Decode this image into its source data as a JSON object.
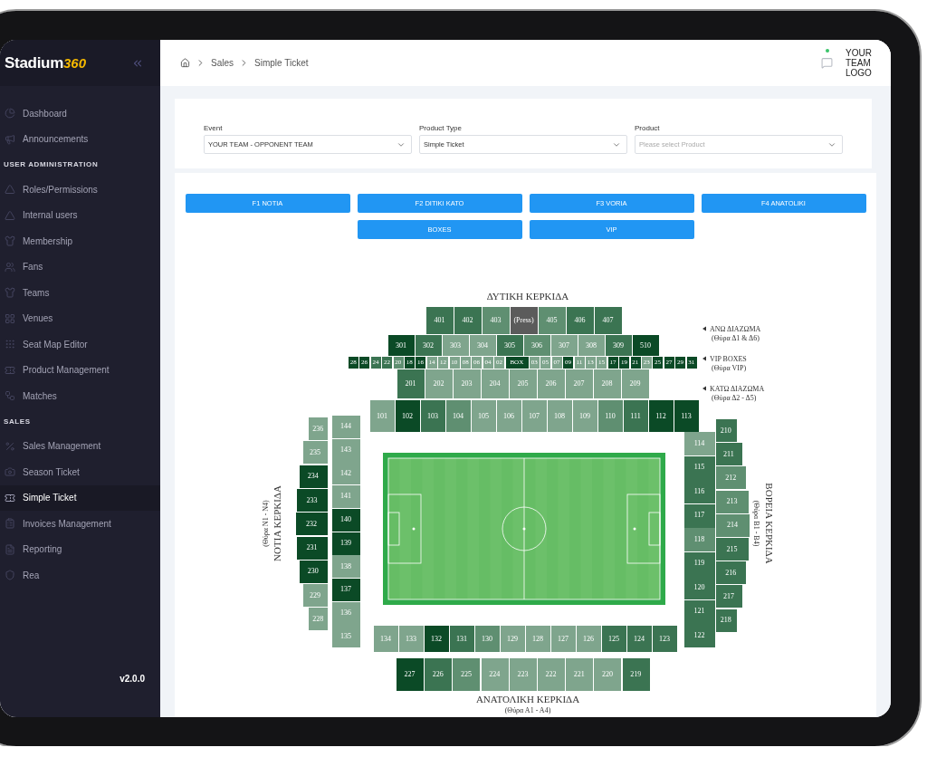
{
  "brand": {
    "name": "Stadium",
    "suffix": "360"
  },
  "sidebar": {
    "items": [
      {
        "kind": "item",
        "label": "Dashboard",
        "selected": false
      },
      {
        "kind": "item",
        "label": "Announcements",
        "selected": false
      },
      {
        "kind": "section",
        "label": "USER ADMINISTRATION"
      },
      {
        "kind": "item",
        "label": "Roles/Permissions",
        "selected": false
      },
      {
        "kind": "item",
        "label": "Internal users",
        "selected": false
      },
      {
        "kind": "item",
        "label": "Membership",
        "selected": false
      },
      {
        "kind": "item",
        "label": "Fans",
        "selected": false
      },
      {
        "kind": "item",
        "label": "Teams",
        "selected": false
      },
      {
        "kind": "item",
        "label": "Venues",
        "selected": false
      },
      {
        "kind": "item",
        "label": "Seat Map Editor",
        "selected": false
      },
      {
        "kind": "item",
        "label": "Product Management",
        "selected": false
      },
      {
        "kind": "item",
        "label": "Matches",
        "selected": false
      },
      {
        "kind": "section",
        "label": "SALES"
      },
      {
        "kind": "item",
        "label": "Sales Management",
        "selected": false
      },
      {
        "kind": "item",
        "label": "Season Ticket",
        "selected": false
      },
      {
        "kind": "item",
        "label": "Simple Ticket",
        "selected": true
      },
      {
        "kind": "item",
        "label": "Invoices Management",
        "selected": false
      },
      {
        "kind": "item",
        "label": "Reporting",
        "selected": false
      },
      {
        "kind": "item",
        "label": "Rea",
        "selected": false
      }
    ],
    "version": "v2.0.0"
  },
  "breadcrumb": [
    "Sales",
    "Simple Ticket"
  ],
  "team_logo": "YOUR TEAM LOGO",
  "filters": [
    {
      "label": "Event",
      "value": "YOUR TEAM - OPPONENT TEAM"
    },
    {
      "label": "Product Type",
      "value": "Simple Ticket"
    },
    {
      "label": "Product",
      "placeholder": "Please select Product"
    }
  ],
  "zone_buttons": [
    "F1 NOTIA",
    "F2 DITIKI KATO",
    "F3 VORIA",
    "F4 ANATOLIKI",
    "BOXES",
    "VIP"
  ],
  "stadium": {
    "west": {
      "name": "ΔΥΤΙΚΗ ΚΕΡΚΙΔΑ",
      "tiers": [
        {
          "sections": [
            {
              "label": "401",
              "color": "#3b7452"
            },
            {
              "label": "402",
              "color": "#3b7452"
            },
            {
              "label": "403",
              "color": "#5f8f71"
            },
            {
              "label": "(Press)",
              "color": "#5b5b5b"
            },
            {
              "label": "405",
              "color": "#5f8f71"
            },
            {
              "label": "406",
              "color": "#3b7452"
            },
            {
              "label": "407",
              "color": "#3b7452"
            }
          ]
        },
        {
          "sections": [
            {
              "label": "301",
              "color": "#0b4a26"
            },
            {
              "label": "302",
              "color": "#3b7452"
            },
            {
              "label": "303",
              "color": "#7fa58d"
            },
            {
              "label": "304",
              "color": "#7fa58d"
            },
            {
              "label": "305",
              "color": "#3b7452"
            },
            {
              "label": "306",
              "color": "#5f8f71"
            },
            {
              "label": "307",
              "color": "#7fa58d"
            },
            {
              "label": "308",
              "color": "#7fa58d"
            },
            {
              "label": "309",
              "color": "#3b7452"
            },
            {
              "label": "510",
              "color": "#0b4a26"
            }
          ]
        },
        {
          "sections": [
            {
              "label": "28",
              "color": "#0b4a26"
            },
            {
              "label": "26",
              "color": "#0b4a26"
            },
            {
              "label": "24",
              "color": "#3b7452"
            },
            {
              "label": "22",
              "color": "#3b7452"
            },
            {
              "label": "20",
              "color": "#5f8f71"
            },
            {
              "label": "18",
              "color": "#0b4a26"
            },
            {
              "label": "16",
              "color": "#0b4a26"
            },
            {
              "label": "14",
              "color": "#7fa58d"
            },
            {
              "label": "12",
              "color": "#7fa58d"
            },
            {
              "label": "10",
              "color": "#7fa58d"
            },
            {
              "label": "08",
              "color": "#7fa58d"
            },
            {
              "label": "06",
              "color": "#7fa58d"
            },
            {
              "label": "04",
              "color": "#7fa58d"
            },
            {
              "label": "02",
              "color": "#7fa58d"
            },
            {
              "label": "BOX",
              "color": "#0b4a26"
            },
            {
              "label": "03",
              "color": "#7fa58d"
            },
            {
              "label": "05",
              "color": "#7fa58d"
            },
            {
              "label": "07",
              "color": "#7fa58d"
            },
            {
              "label": "09",
              "color": "#0b4a26"
            },
            {
              "label": "11",
              "color": "#7fa58d"
            },
            {
              "label": "13",
              "color": "#7fa58d"
            },
            {
              "label": "15",
              "color": "#7fa58d"
            },
            {
              "label": "17",
              "color": "#0b4a26"
            },
            {
              "label": "19",
              "color": "#0b4a26"
            },
            {
              "label": "21",
              "color": "#0b4a26"
            },
            {
              "label": "23",
              "color": "#7fa58d"
            },
            {
              "label": "25",
              "color": "#0b4a26"
            },
            {
              "label": "27",
              "color": "#0b4a26"
            },
            {
              "label": "29",
              "color": "#0b4a26"
            },
            {
              "label": "31",
              "color": "#0b4a26"
            }
          ]
        },
        {
          "sections": [
            {
              "label": "201",
              "color": "#3b7452"
            },
            {
              "label": "202",
              "color": "#7fa58d"
            },
            {
              "label": "203",
              "color": "#7fa58d"
            },
            {
              "label": "204",
              "color": "#7fa58d"
            },
            {
              "label": "205",
              "color": "#7fa58d"
            },
            {
              "label": "206",
              "color": "#7fa58d"
            },
            {
              "label": "207",
              "color": "#7fa58d"
            },
            {
              "label": "208",
              "color": "#7fa58d"
            },
            {
              "label": "209",
              "color": "#7fa58d"
            }
          ]
        },
        {
          "sections": [
            {
              "label": "101",
              "color": "#7fa58d"
            },
            {
              "label": "102",
              "color": "#0b4a26"
            },
            {
              "label": "103",
              "color": "#3b7452"
            },
            {
              "label": "104",
              "color": "#5f8f71"
            },
            {
              "label": "105",
              "color": "#7fa58d"
            },
            {
              "label": "106",
              "color": "#7fa58d"
            },
            {
              "label": "107",
              "color": "#7fa58d"
            },
            {
              "label": "108",
              "color": "#7fa58d"
            },
            {
              "label": "109",
              "color": "#7fa58d"
            },
            {
              "label": "110",
              "color": "#5f8f71"
            },
            {
              "label": "111",
              "color": "#3b7452"
            },
            {
              "label": "112",
              "color": "#0b4a26"
            },
            {
              "label": "113",
              "color": "#0b4a26"
            }
          ]
        }
      ]
    },
    "legend": [
      {
        "label": "ΑΝΩ ΔΙΑΖΩΜΑ",
        "gate": "(Θύρα Δ1 & Δ6)"
      },
      {
        "label": "VIP BOXES",
        "gate": "(Θύρα VIP)"
      },
      {
        "label": "ΚΑΤΩ ΔΙΑΖΩΜΑ",
        "gate": "(Θύρα Δ2 - Δ5)"
      }
    ],
    "south": {
      "name": "ΝΟΤΙΑ ΚΕΡΚΙΔΑ",
      "gate": "(Θύρα Ν1 - Ν4)",
      "inner": [
        {
          "label": "144",
          "color": "#7fa58d"
        },
        {
          "label": "143",
          "color": "#7fa58d"
        },
        {
          "label": "142",
          "color": "#7fa58d"
        },
        {
          "label": "141",
          "color": "#7fa58d"
        },
        {
          "label": "140",
          "color": "#0b4a26"
        },
        {
          "label": "139",
          "color": "#0b4a26"
        },
        {
          "label": "138",
          "color": "#7fa58d"
        },
        {
          "label": "137",
          "color": "#0b4a26"
        },
        {
          "label": "136",
          "color": "#7fa58d"
        },
        {
          "label": "135",
          "color": "#7fa58d"
        }
      ],
      "outer": [
        {
          "label": "236",
          "color": "#7fa58d"
        },
        {
          "label": "235",
          "color": "#7fa58d"
        },
        {
          "label": "234",
          "color": "#0b4a26"
        },
        {
          "label": "233",
          "color": "#0b4a26"
        },
        {
          "label": "232",
          "color": "#0b4a26"
        },
        {
          "label": "231",
          "color": "#0b4a26"
        },
        {
          "label": "230",
          "color": "#0b4a26"
        },
        {
          "label": "229",
          "color": "#7fa58d"
        },
        {
          "label": "228",
          "color": "#7fa58d"
        }
      ]
    },
    "north": {
      "name": "ΒΟΡΕΙΑ ΚΕΡΚΙΔΑ",
      "gate": "(Θύρα Β1 - Β4)",
      "inner": [
        {
          "label": "114",
          "color": "#7fa58d"
        },
        {
          "label": "115",
          "color": "#3b7452"
        },
        {
          "label": "116",
          "color": "#3b7452"
        },
        {
          "label": "117",
          "color": "#3b7452"
        },
        {
          "label": "118",
          "color": "#5f8f71"
        },
        {
          "label": "119",
          "color": "#3b7452"
        },
        {
          "label": "120",
          "color": "#3b7452"
        },
        {
          "label": "121",
          "color": "#3b7452"
        },
        {
          "label": "122",
          "color": "#3b7452"
        }
      ],
      "outer": [
        {
          "label": "210",
          "color": "#3b7452"
        },
        {
          "label": "211",
          "color": "#3b7452"
        },
        {
          "label": "212",
          "color": "#5f8f71"
        },
        {
          "label": "213",
          "color": "#5f8f71"
        },
        {
          "label": "214",
          "color": "#5f8f71"
        },
        {
          "label": "215",
          "color": "#3b7452"
        },
        {
          "label": "216",
          "color": "#3b7452"
        },
        {
          "label": "217",
          "color": "#3b7452"
        },
        {
          "label": "218",
          "color": "#3b7452"
        }
      ]
    },
    "east": {
      "name": "ΑΝΑΤΟΛΙΚΗ ΚΕΡΚΙΔΑ",
      "gate": "(Θύρα Α1 - Α4)",
      "tiers": [
        {
          "sections": [
            {
              "label": "134",
              "color": "#7fa58d"
            },
            {
              "label": "133",
              "color": "#7fa58d"
            },
            {
              "label": "132",
              "color": "#0b4a26"
            },
            {
              "label": "131",
              "color": "#3b7452"
            },
            {
              "label": "130",
              "color": "#5f8f71"
            },
            {
              "label": "129",
              "color": "#7fa58d"
            },
            {
              "label": "128",
              "color": "#7fa58d"
            },
            {
              "label": "127",
              "color": "#7fa58d"
            },
            {
              "label": "126",
              "color": "#7fa58d"
            },
            {
              "label": "125",
              "color": "#3b7452"
            },
            {
              "label": "124",
              "color": "#3b7452"
            },
            {
              "label": "123",
              "color": "#3b7452"
            }
          ]
        },
        {
          "sections": [
            {
              "label": "227",
              "color": "#0b4a26"
            },
            {
              "label": "226",
              "color": "#3b7452"
            },
            {
              "label": "225",
              "color": "#5f8f71"
            },
            {
              "label": "224",
              "color": "#7fa58d"
            },
            {
              "label": "223",
              "color": "#7fa58d"
            },
            {
              "label": "222",
              "color": "#7fa58d"
            },
            {
              "label": "221",
              "color": "#7fa58d"
            },
            {
              "label": "220",
              "color": "#7fa58d"
            },
            {
              "label": "219",
              "color": "#3b7452"
            }
          ]
        }
      ]
    }
  }
}
